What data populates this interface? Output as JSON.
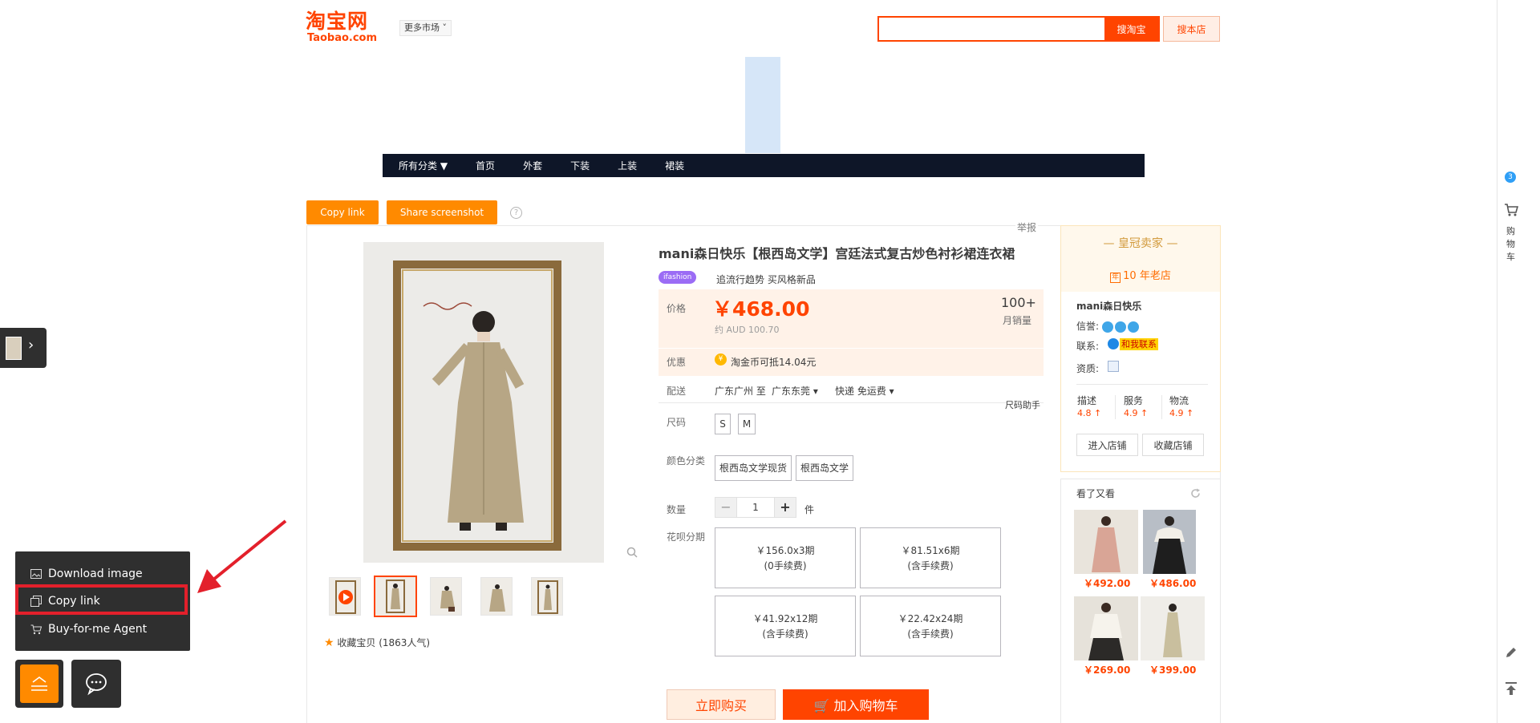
{
  "header": {
    "logo_cn": "淘宝网",
    "logo_en": "Taobao.com",
    "market_label": "更多市场",
    "search_placeholder": "",
    "search_button": "搜淘宝",
    "search_shop_button": "搜本店"
  },
  "shop_nav": {
    "items": [
      "所有分类 ▼",
      "首页",
      "外套",
      "下装",
      "上装",
      "裙装"
    ]
  },
  "actions": {
    "copy_link": "Copy link",
    "share_screenshot": "Share screenshot",
    "help": "?",
    "report": "举报"
  },
  "product": {
    "title": "mani森日快乐【根西岛文学】宫廷法式复古炒色衬衫裙连衣裙",
    "promo_tag": "ifashion",
    "promo_text": "追流行趋势 买风格新品",
    "price_label": "价格",
    "price": "￥468.00",
    "price_aud": "约 AUD 100.70",
    "sales_count": "100+",
    "sales_label": "月销量",
    "discount_label": "优惠",
    "discount_text": "淘金币可抵14.04元",
    "ship_label": "配送",
    "ship_from": "广东广州 至",
    "ship_to": "广东东莞 ▾",
    "ship_method": "快递 免运费 ▾",
    "size_helper": "尺码助手",
    "size_label": "尺码",
    "sizes": [
      "S",
      "M"
    ],
    "color_label": "颜色分类",
    "colors": [
      "根西岛文学现货",
      "根西岛文学"
    ],
    "qty_label": "数量",
    "qty_value": "1",
    "qty_minus": "−",
    "qty_plus": "+",
    "qty_unit": "件",
    "installment_label": "花呗分期",
    "installments": [
      {
        "line1": "￥156.0x3期",
        "line2": "(0手续费)"
      },
      {
        "line1": "￥81.51x6期",
        "line2": "(含手续费)"
      },
      {
        "line1": "￥41.92x12期",
        "line2": "(含手续费)"
      },
      {
        "line1": "￥22.42x24期",
        "line2": "(含手续费)"
      }
    ],
    "buy_now": "立即购买",
    "add_cart": "加入购物车",
    "favorite": "收藏宝贝 (1863人气)"
  },
  "seller": {
    "crown_title": "— 皇冠卖家 —",
    "years": "10 年老店",
    "years_icon": "年",
    "name": "mani森日快乐",
    "credit_label": "信誉:",
    "contact_label": "联系:",
    "contact_link": "和我联系",
    "cert_label": "资质:",
    "scores": [
      {
        "label": "描述",
        "value": "4.8 ↑"
      },
      {
        "label": "服务",
        "value": "4.9 ↑"
      },
      {
        "label": "物流",
        "value": "4.9 ↑"
      }
    ],
    "enter_shop": "进入店铺",
    "fav_shop": "收藏店铺"
  },
  "also_viewed": {
    "title": "看了又看",
    "items": [
      {
        "price": "￥492.00"
      },
      {
        "price": "￥486.00"
      },
      {
        "price": "￥269.00"
      },
      {
        "price": "￥399.00"
      }
    ]
  },
  "right_bar": {
    "badge": "3",
    "cart_label": "购物车"
  },
  "context_menu": {
    "items": [
      "Download image",
      "Copy link",
      "Buy-for-me Agent"
    ]
  },
  "colors": {
    "accent": "#ff4400",
    "orange": "#ff8a00",
    "nav_bg": "#0e1628",
    "highlight": "#e3202b"
  }
}
